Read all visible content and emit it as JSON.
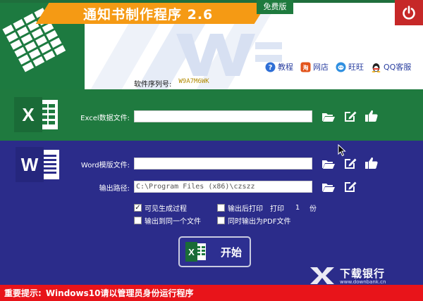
{
  "window": {
    "title": "通知书制作程序 2.6",
    "badge": "免费版",
    "close_icon": "power-icon"
  },
  "top_links": [
    {
      "label": "教程",
      "icon": "help-icon",
      "color": "#2f6fd6"
    },
    {
      "label": "网店",
      "icon": "shop-icon",
      "color": "#e2541b"
    },
    {
      "label": "旺旺",
      "icon": "wangwang-icon",
      "color": "#2f8fe0"
    },
    {
      "label": "QQ客服",
      "icon": "qq-penguin-icon",
      "color": "#222222"
    }
  ],
  "serial": {
    "label": "软件序列号:",
    "value": "W9A7M6WK"
  },
  "excel_section": {
    "logo_letter": "X",
    "label": "Excel数据文件:",
    "value": ""
  },
  "word_section": {
    "logo_letter": "W",
    "template_label": "Word模版文件:",
    "template_value": "",
    "output_label": "输出路径:",
    "output_value": "C:\\Program Files (x86)\\czszz"
  },
  "options": {
    "show_process": {
      "label": "可见生成过程",
      "checked": true
    },
    "print_after": {
      "label": "输出后打印",
      "checked": false
    },
    "print_label": "打印",
    "print_count": "1",
    "print_unit": "份",
    "single_file": {
      "label": "输出到同一个文件",
      "checked": false
    },
    "pdf_output": {
      "label": "同时输出为PDF文件",
      "checked": false
    }
  },
  "start_button": {
    "label": "开始"
  },
  "watermark": {
    "name": "下载银行",
    "url": "www.downbank.cn"
  },
  "footer": {
    "tip_label": "重要提示:",
    "tip_text": "Windows10请以管理员身份运行程序"
  },
  "colors": {
    "excel_green": "#1f7a3f",
    "word_blue": "#2b2c8a",
    "title_orange": "#f59a14",
    "warning_red": "#e8141a"
  }
}
